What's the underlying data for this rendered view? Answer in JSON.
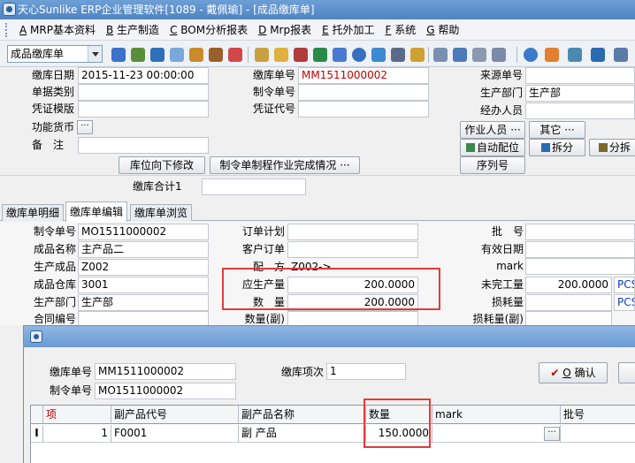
{
  "window": {
    "title": "天心Sunlike ERP企业管理软件[1089 - 戴佩瑜] - [成品缴库单]"
  },
  "menu": [
    {
      "key": "A",
      "label": "MRP基本资料"
    },
    {
      "key": "B",
      "label": "生产制造"
    },
    {
      "key": "C",
      "label": "BOM分析报表"
    },
    {
      "key": "D",
      "label": "Mrp报表"
    },
    {
      "key": "E",
      "label": "托外加工"
    },
    {
      "key": "F",
      "label": "系统"
    },
    {
      "key": "G",
      "label": "帮助"
    }
  ],
  "toolbar": {
    "doc_type": "成品缴库单"
  },
  "header": {
    "date_label": "缴库日期",
    "date_value": "2015-11-23 00:00:00",
    "doc_type_label": "单据类别",
    "voucher_tpl_label": "凭证模版",
    "currency_label": "功能货币",
    "remark_label": "备　注",
    "no_label": "缴库单号",
    "no_value": "MM1511000002",
    "order_label": "制令单号",
    "voucher_code_label": "凭证代号",
    "source_label": "来源单号",
    "dept_label": "生产部门",
    "dept_value": "生产部",
    "handler_label": "经办人员",
    "operator_btn": "作业人员",
    "other_btn": "其它",
    "auto_btn": "自动配位",
    "split_btn": "拆分",
    "split2_btn": "分拆",
    "serial_btn": "序列号",
    "loc_btn": "库位向下修改",
    "process_btn": "制令单制程作业完成情况",
    "total_label": "缴库合计1"
  },
  "tabs": [
    "缴库单明细",
    "缴库单编辑",
    "缴库单浏览"
  ],
  "detail": {
    "order_label": "制令单号",
    "order_value": "MO1511000002",
    "product_name_label": "成品名称",
    "product_name_value": "主产品二",
    "product_label": "生产成品",
    "product_value": "Z002",
    "warehouse_label": "成品仓库",
    "warehouse_value": "3001",
    "dept_label": "生产部门",
    "dept_value": "生产部",
    "contract_label": "合同编号",
    "plan_label": "订单计划",
    "cust_order_label": "客户订单",
    "recipe_label": "配　方",
    "recipe_value": "Z002->",
    "should_qty_label": "应生产量",
    "should_qty_value": "200.0000",
    "qty_label": "数　量",
    "qty_value": "200.0000",
    "qty_sub_label": "数量(副)",
    "batch_label": "批　号",
    "expiry_label": "有效日期",
    "mark_label": "mark",
    "unfinished_label": "未完工量",
    "unfinished_value": "200.0000",
    "unit_value": "PCS",
    "loss_label": "损耗量",
    "loss_unit": "PCS",
    "loss_sub_label": "损耗量(副)"
  },
  "dialog": {
    "no_label": "缴库单号",
    "no_value": "MM1511000002",
    "order_label": "制令单号",
    "order_value": "MO1511000002",
    "item_label": "缴库项次",
    "item_value": "1",
    "ok_key": "O",
    "ok_label": "确认",
    "columns": [
      "项",
      "副产品代号",
      "副产品名称",
      "数量",
      "mark",
      "批号"
    ],
    "rows": [
      {
        "marker": "I",
        "seq": "1",
        "code": "F0001",
        "name": "副 产品",
        "qty": "150.0000",
        "mark": "",
        "batch": ""
      }
    ]
  },
  "colors": {
    "title_bar": "#5a8dca",
    "highlight": "#e43a3a",
    "red_text": "#c00000"
  }
}
